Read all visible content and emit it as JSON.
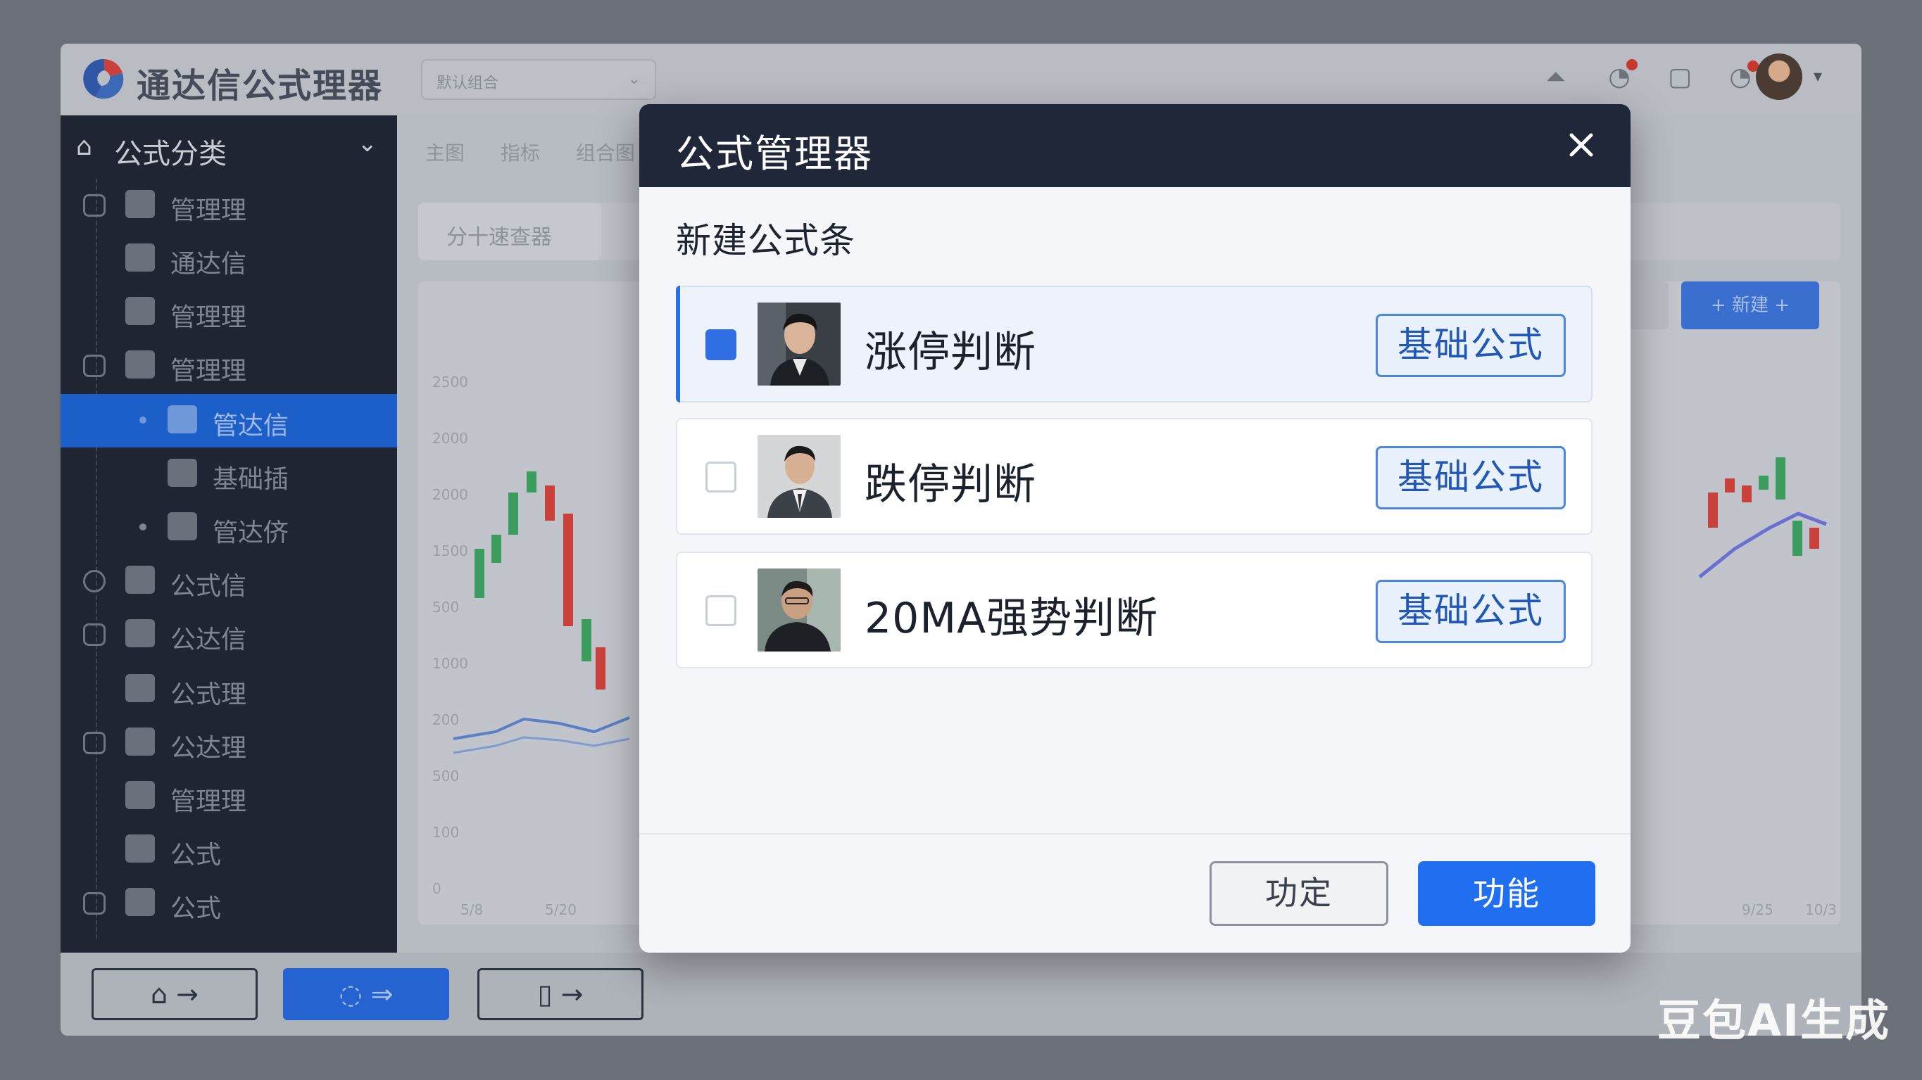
{
  "app": {
    "title": "通达信公式理器",
    "header_select": "默认组合",
    "sidebar_header": "公式分类",
    "sidebar_items": [
      {
        "label": "管理理"
      },
      {
        "label": "通达信"
      },
      {
        "label": "管理理"
      },
      {
        "label": "管理理"
      },
      {
        "label": "管达信"
      },
      {
        "label": "基础插"
      },
      {
        "label": "管达侪"
      },
      {
        "label": "公式信"
      },
      {
        "label": "公达信"
      },
      {
        "label": "公式理"
      },
      {
        "label": "公达理"
      },
      {
        "label": "管理理"
      },
      {
        "label": "公式"
      },
      {
        "label": "公式"
      }
    ],
    "tabs": [
      "主图",
      "指标",
      "组合图"
    ],
    "top_pill": "分十速查器",
    "add_button": "+ 新建 +"
  },
  "modal": {
    "title": "公式管理器",
    "section_title": "新建公式条",
    "items": [
      {
        "name": "涨停判断",
        "tag": "基础公式",
        "checked": true
      },
      {
        "name": "跌停判断",
        "tag": "基础公式",
        "checked": false
      },
      {
        "name": "20MA强势判断",
        "tag": "基础公式",
        "checked": false
      }
    ],
    "secondary_button": "功定",
    "primary_button": "功能"
  },
  "watermark": "豆包AI生成",
  "colors": {
    "modal_header": "#1f2738",
    "primary": "#1f6ff0",
    "sidebar_active": "#1d5fc9",
    "tag_border": "#4d86dd"
  }
}
